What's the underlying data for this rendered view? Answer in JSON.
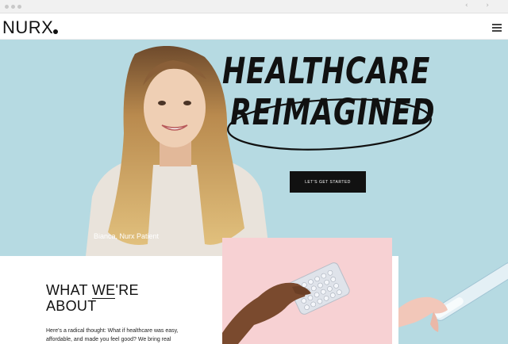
{
  "browser": {
    "nav_arrows": "‹ ›"
  },
  "header": {
    "logo_text": "NURX",
    "menu_icon": "hamburger-menu-icon"
  },
  "hero": {
    "headline_line1": "HEALTHCARE",
    "headline_line2": "REIMAGINED",
    "cta_label": "LET'S GET STARTED",
    "patient_caption": "Bianca, Nurx Patient"
  },
  "about": {
    "heading_prefix": "WHAT ",
    "heading_emphasis": "WE",
    "heading_suffix": "'RE",
    "heading_line2": "ABOUT",
    "body": "Here's a radical thought: What if healthcare was easy, affordable, and made you feel good? We bring real"
  },
  "colors": {
    "hero_background": "#b6dae2",
    "pink_panel": "#f7d1d3",
    "cta_background": "#111111"
  }
}
